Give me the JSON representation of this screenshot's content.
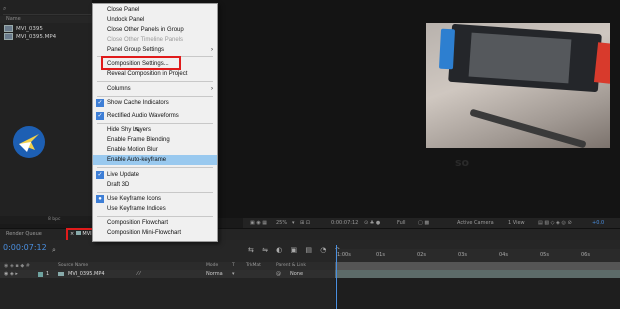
{
  "project": {
    "name_header": "Name",
    "items": [
      "MVI_0395",
      "MVI_0395.MP4"
    ],
    "bpc": "8 bpc"
  },
  "menu": {
    "items": [
      {
        "label": "Close Panel",
        "disabled": false
      },
      {
        "label": "Undock Panel",
        "disabled": false
      },
      {
        "label": "Close Other Panels in Group",
        "disabled": false
      },
      {
        "label": "Close Other Timeline Panels",
        "disabled": true
      },
      {
        "label": "Panel Group Settings",
        "submenu": true
      },
      {
        "label": "Composition Settings...",
        "boxed": true
      },
      {
        "label": "Reveal Composition in Project"
      },
      {
        "label": "Columns",
        "submenu": true
      },
      {
        "label": "Show Cache Indicators",
        "checked": true
      },
      {
        "label": "Rectified Audio Waveforms",
        "checked": true
      },
      {
        "label": "Hide Shy Layers"
      },
      {
        "label": "Enable Frame Blending"
      },
      {
        "label": "Enable Motion Blur"
      },
      {
        "label": "Enable Auto-keyframe",
        "highlighted": true
      },
      {
        "label": "Live Update",
        "checked": true
      },
      {
        "label": "Draft 3D"
      },
      {
        "label": "Use Keyframe Icons",
        "checked": true
      },
      {
        "label": "Use Keyframe Indices"
      },
      {
        "label": "Composition Flowchart"
      },
      {
        "label": "Composition Mini-Flowchart"
      }
    ]
  },
  "viewer": {
    "zoom": "25%",
    "timecode": "0:00:07:12",
    "resolution": "Full",
    "camera": "Active Camera",
    "views": "1 View",
    "exposure": "+0.0",
    "watermark": "so"
  },
  "timeline": {
    "tabs": [
      "Render Queue",
      "MVI"
    ],
    "current_time": "0:00:07:12",
    "columns": [
      "Source Name",
      "Mode",
      "T",
      "TrkMat",
      "Parent & Link"
    ],
    "layer": {
      "index": "1",
      "name": "MVI_0395.MP4",
      "mode": "Norma",
      "parent": "None"
    },
    "ruler": [
      "1:00s",
      "01s",
      "02s",
      "03s",
      "04s",
      "05s",
      "06s"
    ]
  },
  "colors": {
    "highlight": "#99c9ef",
    "annotation": "#e01b1b",
    "accent": "#4a8fe0"
  }
}
